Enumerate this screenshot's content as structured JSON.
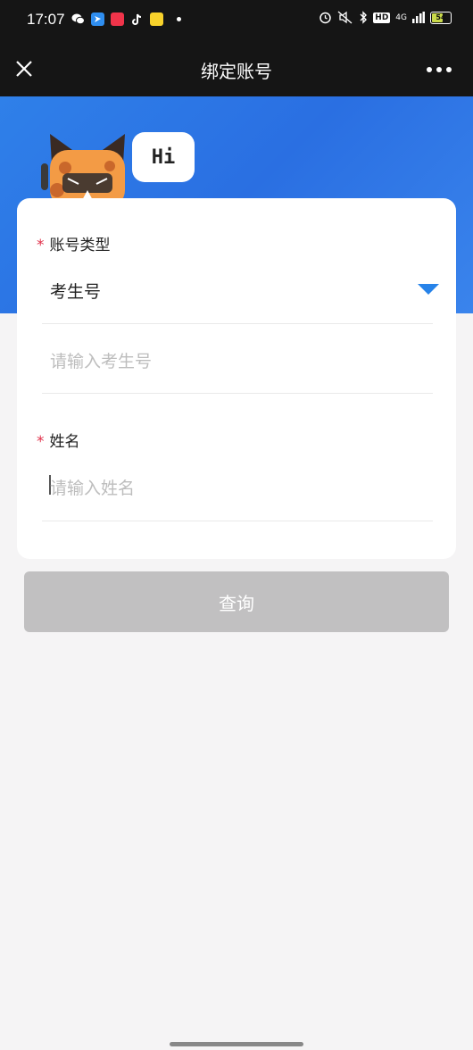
{
  "status_bar": {
    "time": "17:07",
    "battery": "54",
    "network": "4G",
    "hd": "HD",
    "app_icons": [
      "wechat-icon",
      "app-blue-icon",
      "red-app-icon",
      "tiktok-icon",
      "meituan-icon"
    ]
  },
  "nav": {
    "title": "绑定账号",
    "close_icon": "close-icon",
    "more_icon": "more-icon"
  },
  "banner": {
    "bubble_text": "Hi",
    "color": "#2f80e9"
  },
  "form": {
    "account_type": {
      "required_mark": "*",
      "label": "账号类型",
      "selected": "考生号"
    },
    "account_input": {
      "placeholder": "请输入考生号"
    },
    "name": {
      "required_mark": "*",
      "label": "姓名",
      "placeholder": "请输入姓名"
    }
  },
  "query_button": {
    "label": "查询",
    "color": "#c1c0c1"
  },
  "colors": {
    "accent": "#2783e9",
    "required": "#e0304a"
  }
}
